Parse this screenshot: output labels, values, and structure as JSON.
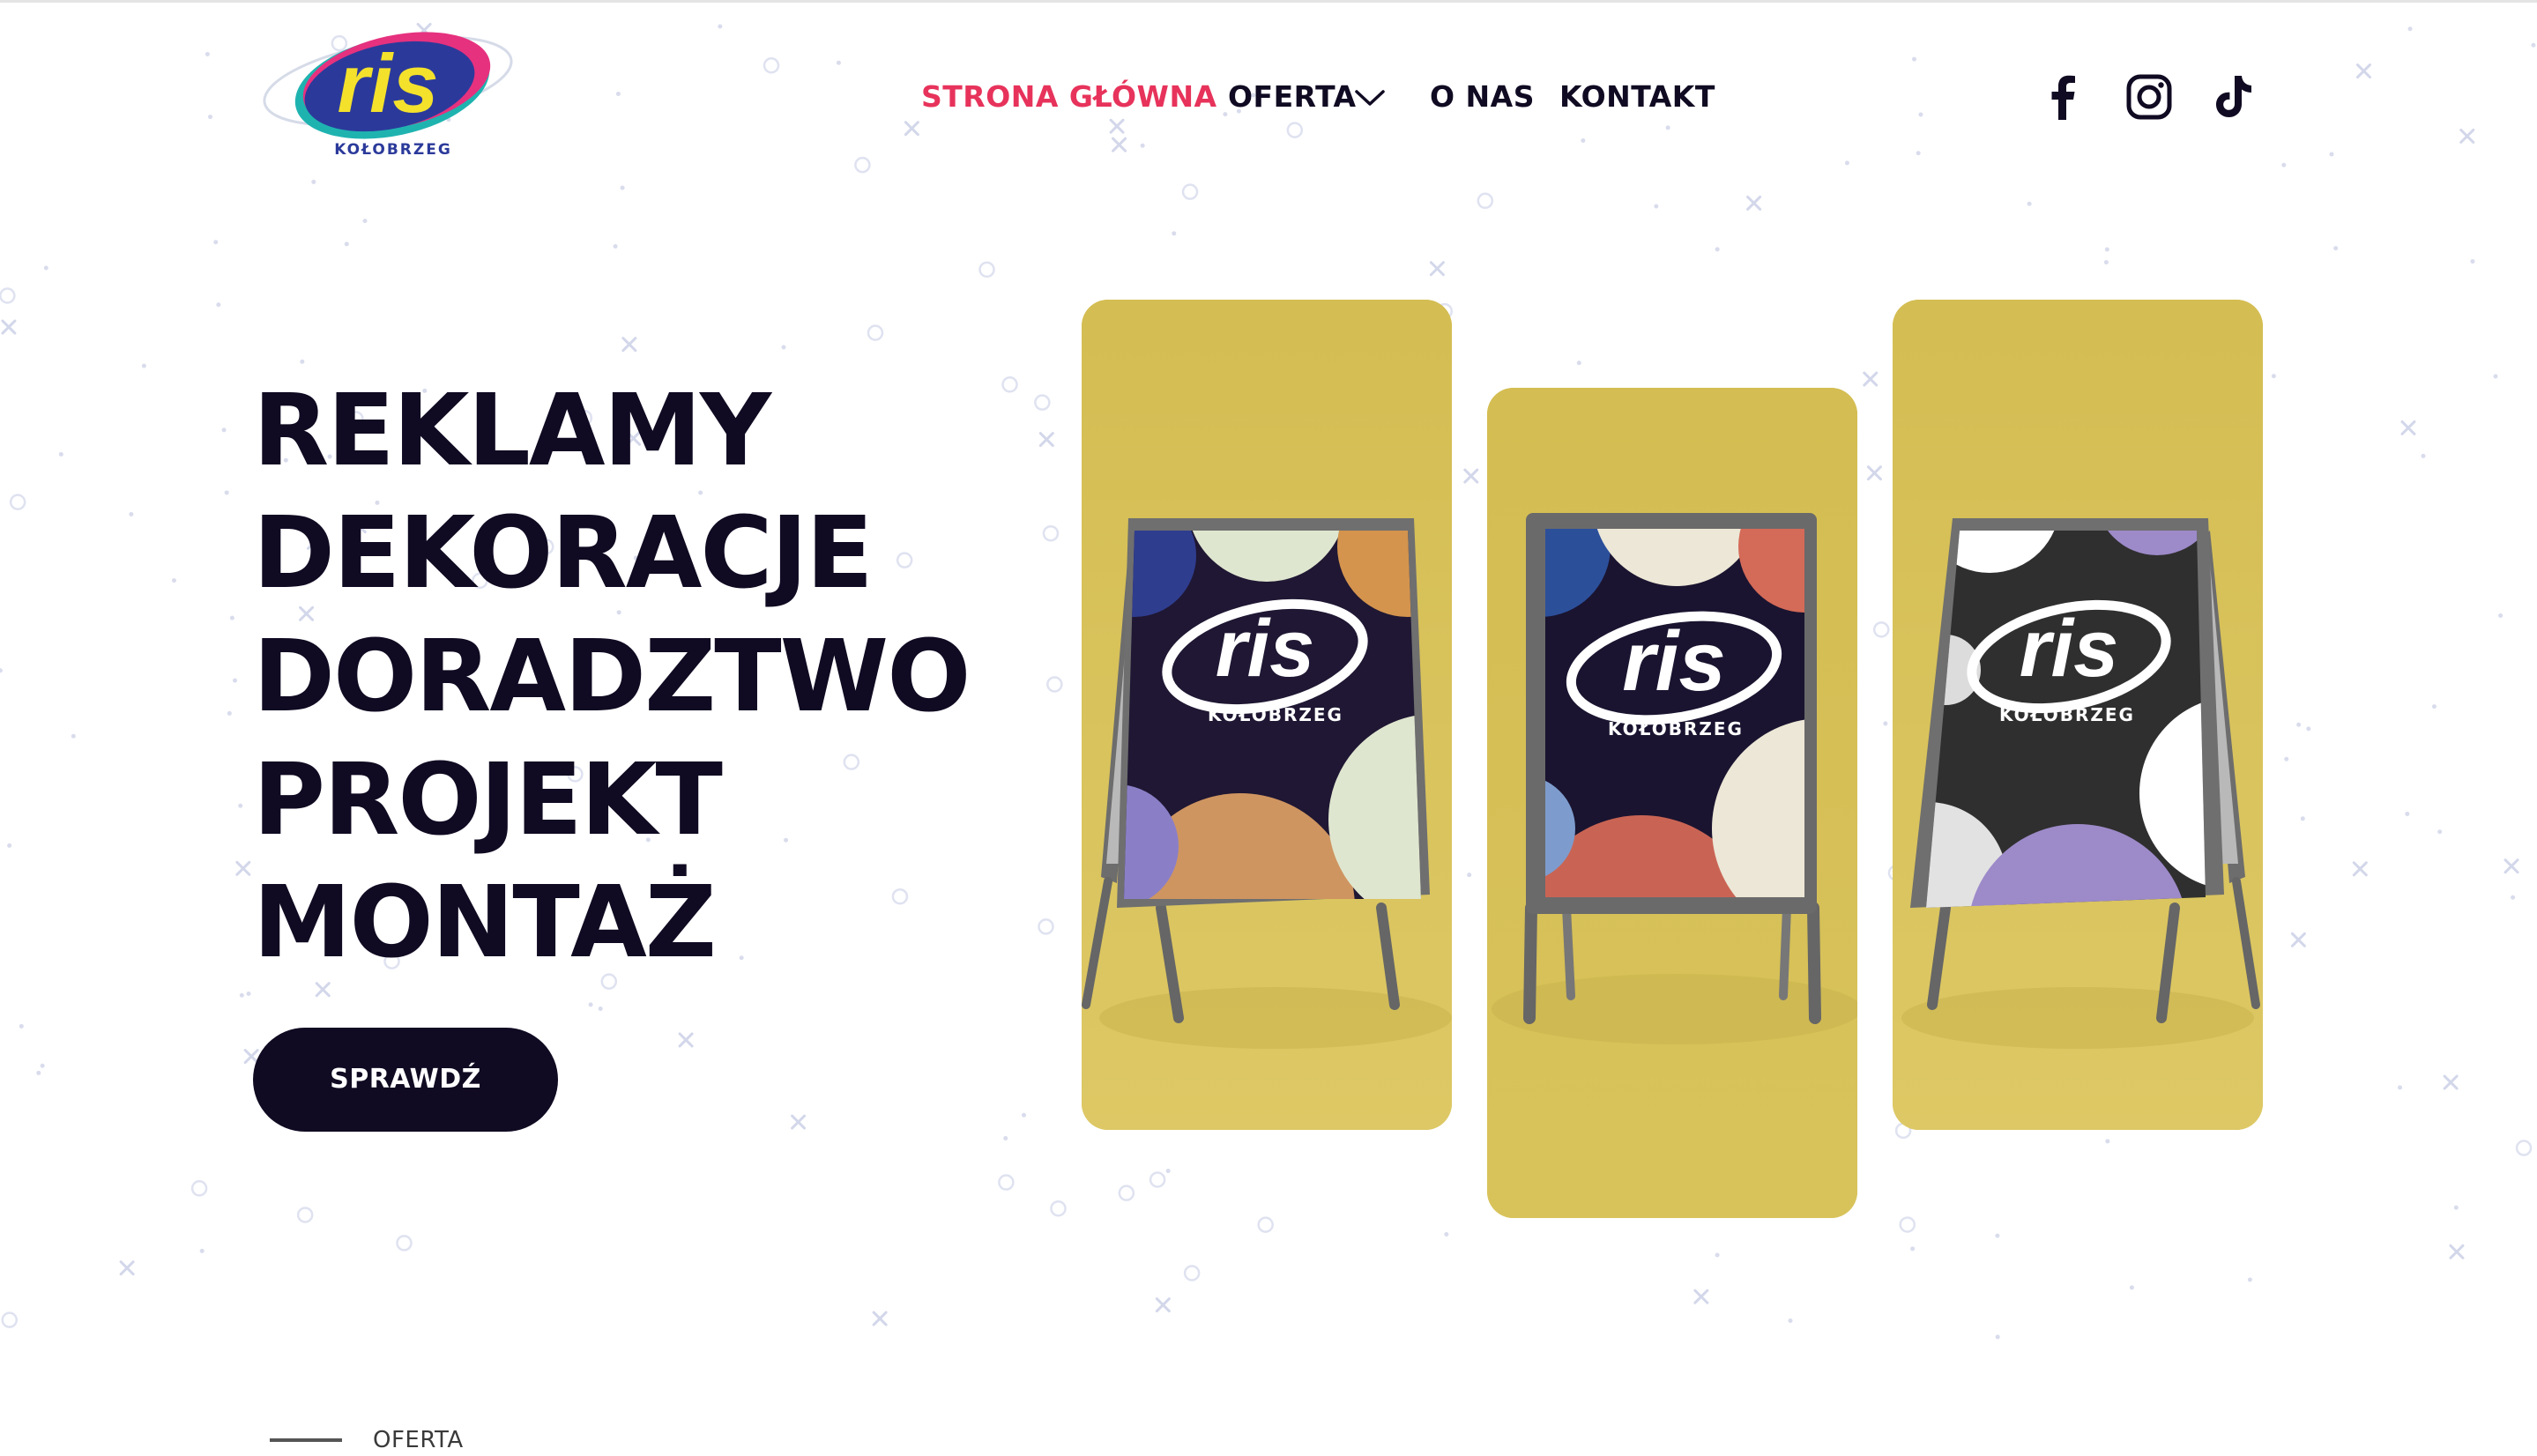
{
  "brand": {
    "logo_word": "ris",
    "logo_city": "KOŁOBRZEG",
    "colors": {
      "navy": "#100a22",
      "accent_pink": "#e7335b",
      "logo_blue": "#2b3a9a",
      "logo_yellow": "#f4e12c",
      "card_yellow": "#d8c35b"
    }
  },
  "nav": {
    "items": [
      {
        "label": "STRONA GŁÓWNA",
        "active": true
      },
      {
        "label": "OFERTA",
        "has_dropdown": true,
        "icon": "chevron-down-icon"
      },
      {
        "label": "O NAS"
      },
      {
        "label": "KONTAKT"
      }
    ]
  },
  "social": [
    "facebook-icon",
    "instagram-icon",
    "tiktok-icon"
  ],
  "hero": {
    "lines": [
      "REKLAMY",
      "DEKORACJE",
      "DORADZTWO",
      "PROJEKT",
      "MONTAŻ"
    ],
    "cta_label": "SPRAWDŹ"
  },
  "gallery": {
    "cards": [
      {
        "sign_word": "ris",
        "sign_city": "KOŁOBRZEG",
        "poster_bg": "#1f1733",
        "blobs": [
          "#2f3d8f",
          "#dfe6cf",
          "#d4944e",
          "#cf9560",
          "#dfe6cf",
          "#8a7fc7"
        ]
      },
      {
        "sign_word": "ris",
        "sign_city": "KOŁOBRZEG",
        "poster_bg": "#1a1430",
        "blobs": [
          "#2c4f9a",
          "#ece7d6",
          "#d46a58",
          "#c96454",
          "#ece7d6",
          "#7d9ccd"
        ]
      },
      {
        "sign_word": "ris",
        "sign_city": "KOŁOBRZEG",
        "poster_bg": "#2f2f2f",
        "blobs": [
          "#ffffff",
          "#9d8ac9",
          "#e2e2e2",
          "#ffffff",
          "#9d8ac9",
          "#dcdcdc"
        ]
      }
    ]
  },
  "next_section": {
    "label": "OFERTA"
  }
}
